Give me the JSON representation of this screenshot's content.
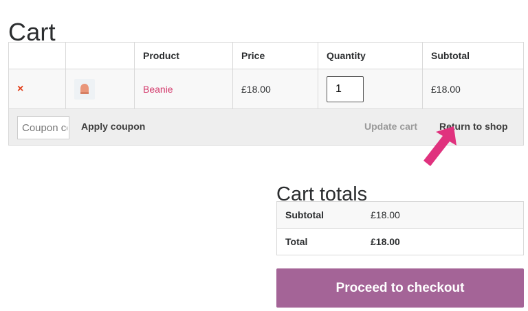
{
  "page": {
    "title": "Cart"
  },
  "cart": {
    "headers": [
      "",
      "",
      "Product",
      "Price",
      "Quantity",
      "Subtotal"
    ],
    "items": [
      {
        "remove_symbol": "×",
        "thumbnail_icon": "beanie-thumbnail",
        "product": "Beanie",
        "price": "£18.00",
        "quantity": "1",
        "subtotal": "£18.00"
      }
    ],
    "actions": {
      "coupon_placeholder": "Coupon code",
      "apply_coupon_label": "Apply coupon",
      "update_cart_label": "Update cart",
      "return_to_shop_label": "Return to shop"
    }
  },
  "totals": {
    "title": "Cart totals",
    "rows": [
      {
        "label": "Subtotal",
        "value": "£18.00"
      },
      {
        "label": "Total",
        "value": "£18.00"
      }
    ],
    "checkout_label": "Proceed to checkout"
  },
  "colors": {
    "accent": "#a46497",
    "product_link": "#d33a6c",
    "remove": "#e2401c",
    "arrow": "#e0327e"
  },
  "annotation": {
    "icon": "pointer-arrow-icon",
    "target": "Return to shop"
  }
}
